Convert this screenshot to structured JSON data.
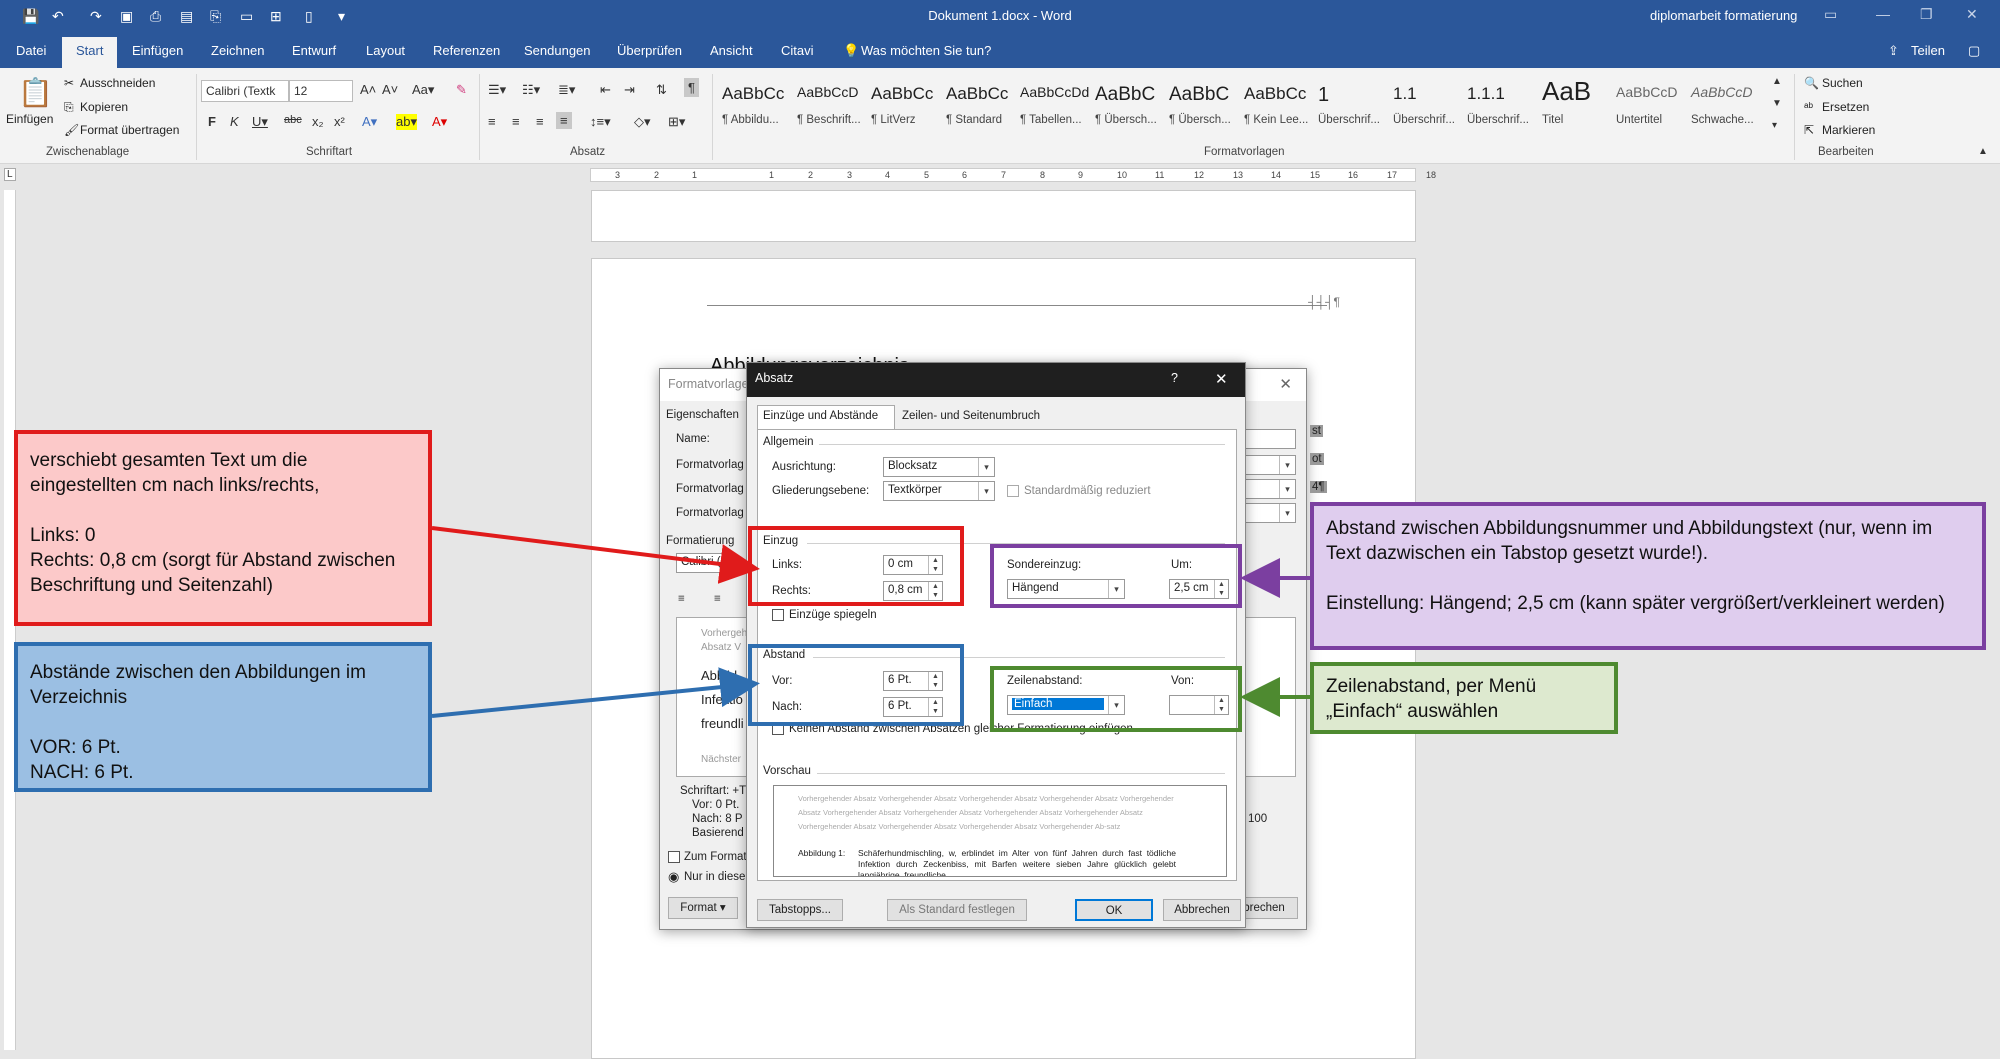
{
  "titlebar": {
    "doc_title": "Dokument 1.docx - Word",
    "right_title": "diplomarbeit formatierung",
    "minimize": "—",
    "restore": "❐",
    "close": "✕"
  },
  "menu": {
    "tabs": [
      "Datei",
      "Start",
      "Einfügen",
      "Zeichnen",
      "Entwurf",
      "Layout",
      "Referenzen",
      "Sendungen",
      "Überprüfen",
      "Ansicht",
      "Citavi"
    ],
    "active": "Start",
    "tell_me": "Was möchten Sie tun?",
    "share": "Teilen"
  },
  "ribbon": {
    "clipboard": {
      "paste": "Einfügen",
      "cut": "Ausschneiden",
      "copy": "Kopieren",
      "format_painter": "Format übertragen",
      "group": "Zwischenablage"
    },
    "font": {
      "name": "Calibri (Textk",
      "size": "12",
      "group": "Schriftart"
    },
    "paragraph": {
      "group": "Absatz"
    },
    "styles": {
      "group": "Formatvorlagen",
      "items": [
        {
          "sample": "AaBbCc",
          "name": "¶ Abbildu..."
        },
        {
          "sample": "AaBbCcD",
          "name": "¶ Beschrift..."
        },
        {
          "sample": "AaBbCc",
          "name": "¶ LitVerz"
        },
        {
          "sample": "AaBbCc",
          "name": "¶ Standard"
        },
        {
          "sample": "AaBbCcDd",
          "name": "¶ Tabellen..."
        },
        {
          "sample": "AaBbC",
          "name": "¶ Übersch..."
        },
        {
          "sample": "AaBbC",
          "name": "¶ Übersch..."
        },
        {
          "sample": "AaBbCc",
          "name": "¶ Kein Lee..."
        },
        {
          "sample": "1",
          "name": "Überschrif..."
        },
        {
          "sample": "1.1",
          "name": "Überschrif..."
        },
        {
          "sample": "1.1.1",
          "name": "Überschrif..."
        },
        {
          "sample": "AaB",
          "name": "Titel"
        },
        {
          "sample": "AaBbCcD",
          "name": "Untertitel"
        },
        {
          "sample": "AaBbCcD",
          "name": "Schwache..."
        }
      ]
    },
    "editing": {
      "find": "Suchen",
      "replace": "Ersetzen",
      "select": "Markieren",
      "group": "Bearbeiten"
    }
  },
  "document": {
    "heading_fragment": "Abbildungsverzeichnis",
    "field_marker": "┤┤┤¶"
  },
  "format_dialog": {
    "title": "Formatvorlage",
    "properties": "Eigenschaften",
    "name": "Name:",
    "type1": "Formatvorlag",
    "type2": "Formatvorlag",
    "type3": "Formatvorlag",
    "formatting": "Formatierung",
    "font": "Calibri (",
    "preview_lines": [
      "Vorhergeh",
      "Absatz V",
      "Abbild",
      "Infektio",
      "freundli",
      "Nächster"
    ],
    "desc": [
      "Schriftart: +T",
      "Vor: 0 Pt.",
      "Nach: 8 P",
      "Basierend"
    ],
    "add_gallery": "Zum Format",
    "only_doc": "Nur in diese",
    "format_btn": "Format",
    "cancel_btn": "brechen",
    "right_vals": [
      "st",
      "ot",
      "4¶"
    ]
  },
  "absatz": {
    "title": "Absatz",
    "help": "?",
    "close": "✕",
    "tabs": [
      "Einzüge und Abstände",
      "Zeilen- und Seitenumbruch"
    ],
    "general": "Allgemein",
    "alignment_label": "Ausrichtung:",
    "alignment_value": "Blocksatz",
    "outline_label": "Gliederungsebene:",
    "outline_value": "Textkörper",
    "collapsed": "Standardmäßig reduziert",
    "indent": "Einzug",
    "left_label": "Links:",
    "left_value": "0 cm",
    "right_label": "Rechts:",
    "right_value": "0,8 cm",
    "mirror": "Einzüge spiegeln",
    "special_label": "Sondereinzug:",
    "special_value": "Hängend",
    "by_label": "Um:",
    "by_value": "2,5 cm",
    "spacing": "Abstand",
    "before_label": "Vor:",
    "before_value": "6 Pt.",
    "after_label": "Nach:",
    "after_value": "6 Pt.",
    "line_label": "Zeilenabstand:",
    "line_value": "Einfach",
    "at_label": "Von:",
    "at_value": "",
    "no_space": "Keinen Abstand zwischen Absätzen gleicher Formatierung einfügen",
    "preview": "Vorschau",
    "preview_prev": "Vorhergehender Absatz Vorhergehender Absatz Vorhergehender Absatz Vorhergehender Absatz Vorhergehender Absatz Vorhergehender Absatz Vorhergehender Absatz Vorhergehender Absatz Vorhergehender Absatz Vorhergehender Absatz Vorhergehender Absatz Vorhergehender Absatz Vorhergehender Ab-satz",
    "preview_label": "Abbildung 1:",
    "preview_text": "Schäferhundmischling, w, erblindet im Alter von fünf Jahren durch fast tödliche Infektion durch Zeckenbiss, mit Barfen weitere sieben Jahre glücklich gelebt langjährige, freundliche",
    "tabs_btn": "Tabstopps...",
    "default_btn": "Als Standard festlegen",
    "ok_btn": "OK",
    "cancel_btn": "Abbrechen"
  },
  "annotations": {
    "red": "verschiebt gesamten Text um die eingestellten cm nach links/rechts,\n\nLinks: 0\nRechts: 0,8 cm (sorgt für Abstand zwischen Beschriftung und Seitenzahl)",
    "blue": "Abstände zwischen den Abbildungen im Verzeichnis\n\nVOR: 6 Pt.\nNACH: 6 Pt.",
    "purple": "Abstand zwischen Abbildungsnummer und Abbildungstext (nur, wenn im Text dazwischen ein Tabstop gesetzt wurde!).\n\nEinstellung: Hängend; 2,5 cm (kann später vergrößert/verkleinert werden)",
    "green": "Zeilenabstand, per Menü „Einfach“ auswählen"
  },
  "colors": {
    "word_blue": "#2b579a",
    "red": "#e01b1b",
    "blue": "#2e6eb0",
    "purple": "#7b3fa0",
    "green": "#4e8a30"
  }
}
